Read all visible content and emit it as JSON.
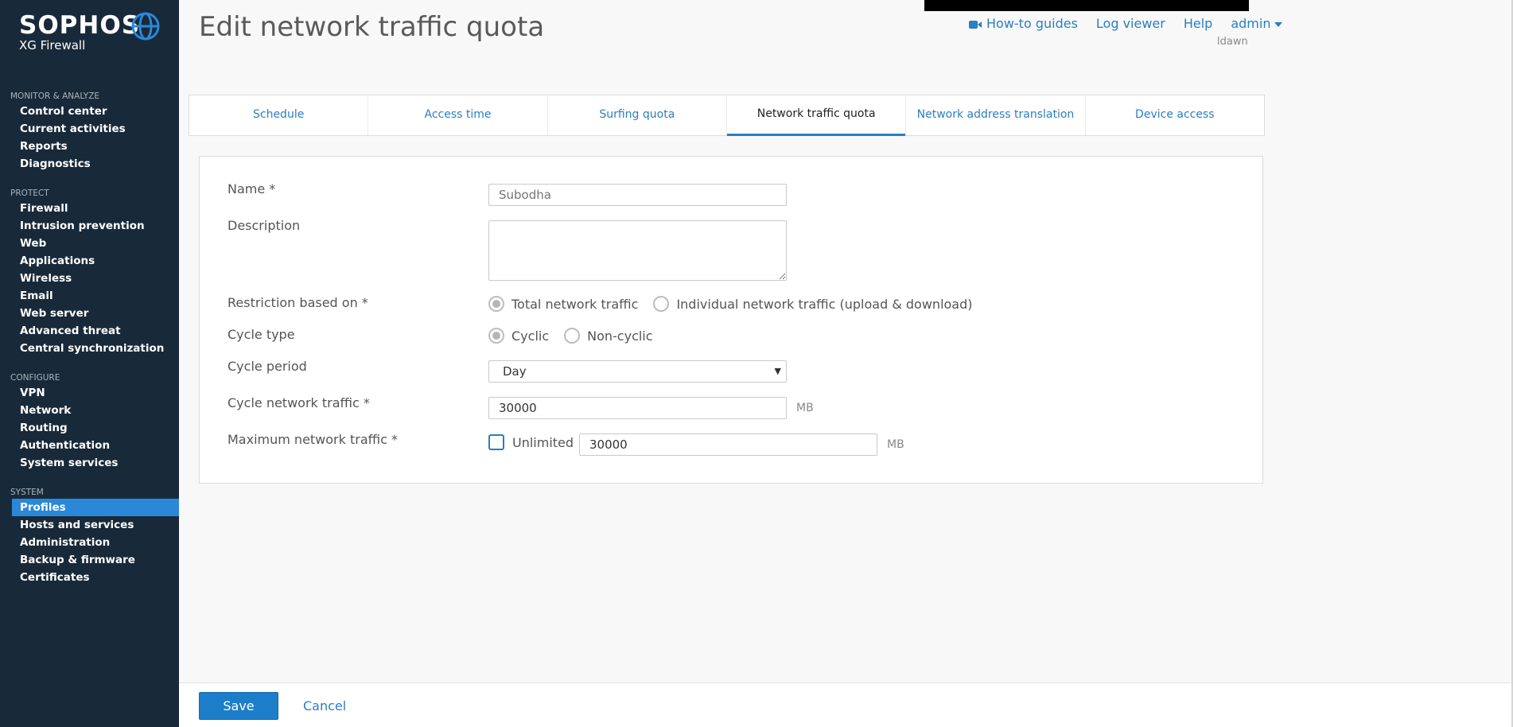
{
  "brand": {
    "name": "SOPHOS",
    "product": "XG Firewall"
  },
  "sidebar": {
    "sections": [
      {
        "title": "MONITOR & ANALYZE",
        "items": [
          "Control center",
          "Current activities",
          "Reports",
          "Diagnostics"
        ]
      },
      {
        "title": "PROTECT",
        "items": [
          "Firewall",
          "Intrusion prevention",
          "Web",
          "Applications",
          "Wireless",
          "Email",
          "Web server",
          "Advanced threat",
          "Central synchronization"
        ]
      },
      {
        "title": "CONFIGURE",
        "items": [
          "VPN",
          "Network",
          "Routing",
          "Authentication",
          "System services"
        ]
      },
      {
        "title": "SYSTEM",
        "items": [
          "Profiles",
          "Hosts and services",
          "Administration",
          "Backup & firmware",
          "Certificates"
        ]
      }
    ],
    "active_item": "Profiles"
  },
  "header": {
    "title": "Edit network traffic quota",
    "links": {
      "howto": "How-to guides",
      "log_viewer": "Log viewer",
      "help": "Help",
      "admin": "admin"
    },
    "username": "ldawn"
  },
  "tabs": [
    "Schedule",
    "Access time",
    "Surfing quota",
    "Network traffic quota",
    "Network address translation",
    "Device access"
  ],
  "active_tab": "Network traffic quota",
  "form": {
    "name_label": "Name *",
    "name_placeholder": "Subodha",
    "description_label": "Description",
    "description_value": "",
    "restriction_label": "Restriction based on *",
    "restriction_options": [
      "Total network traffic",
      "Individual network traffic (upload & download)"
    ],
    "restriction_selected": "Total network traffic",
    "cycle_type_label": "Cycle type",
    "cycle_type_options": [
      "Cyclic",
      "Non-cyclic"
    ],
    "cycle_type_selected": "Cyclic",
    "cycle_period_label": "Cycle period",
    "cycle_period_value": "Day",
    "cycle_traffic_label": "Cycle network traffic *",
    "cycle_traffic_value": "30000",
    "cycle_traffic_unit": "MB",
    "max_traffic_label": "Maximum network traffic *",
    "unlimited_label": "Unlimited",
    "unlimited_checked": false,
    "max_traffic_value": "30000",
    "max_traffic_unit": "MB"
  },
  "footer": {
    "save_label": "Save",
    "cancel_label": "Cancel"
  },
  "colors": {
    "sidebar_bg": "#182a3a",
    "accent": "#2b7ec2",
    "active_nav": "#2b88d8",
    "save_button": "#1c7ec9"
  }
}
